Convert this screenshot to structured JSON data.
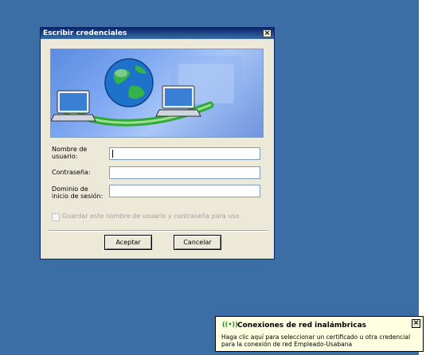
{
  "dialog": {
    "title": "Escribir credenciales",
    "close_glyph": "×",
    "username_label_line1": "Nombre de",
    "username_label_line2": "usuario:",
    "password_label": "Contraseña:",
    "domain_label_line1": "Dominio de",
    "domain_label_line2": "inicio de sesión:",
    "username_value": "",
    "password_value": "",
    "domain_value": "",
    "save_checkbox_label": "Guardar este nombre de usuario y contraseña para uso posterior",
    "save_checked": false,
    "accept_label": "Aceptar",
    "cancel_label": "Cancelar"
  },
  "balloon": {
    "icon": "wireless-network-icon",
    "icon_glyph": "((•))",
    "title": "Conexiones de red inalámbricas",
    "body": "Haga clic aquí para seleccionar un certificado u otra credencial para la conexión de red Empleado-Usabana",
    "close_glyph": "×"
  },
  "colors": {
    "desktop": "#3a6ea5",
    "dialog_bg": "#ece9d8",
    "balloon_bg": "#ffffe1"
  }
}
